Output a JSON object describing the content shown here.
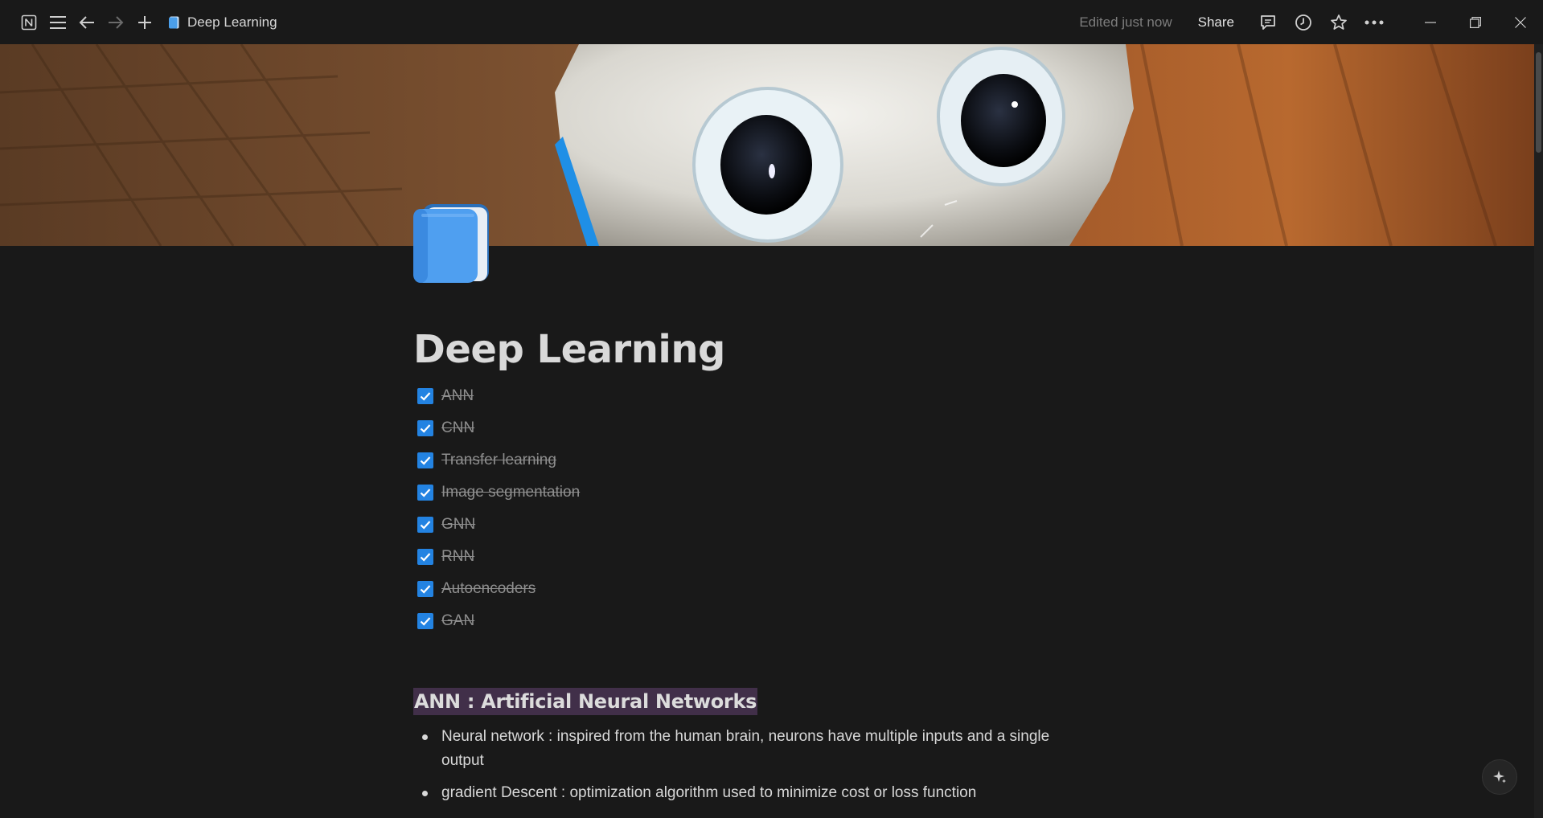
{
  "topbar": {
    "page_title": "Deep Learning",
    "edited": "Edited just now",
    "share": "Share"
  },
  "page": {
    "title": "Deep Learning",
    "icon": "blue-book-icon",
    "todos": [
      {
        "label": "ANN",
        "checked": true
      },
      {
        "label": "CNN",
        "checked": true
      },
      {
        "label": "Transfer learning",
        "checked": true
      },
      {
        "label": "Image segmentation",
        "checked": true
      },
      {
        "label": "GNN",
        "checked": true
      },
      {
        "label": "RNN",
        "checked": true
      },
      {
        "label": "Autoencoders",
        "checked": true
      },
      {
        "label": "GAN",
        "checked": true
      }
    ],
    "heading": "ANN : Artificial Neural Networks",
    "bullets": [
      "Neural network : inspired from the human brain, neurons have multiple inputs and a single output",
      "gradient Descent : optimization algorithm used to minimize cost or loss function"
    ]
  },
  "colors": {
    "background": "#191919",
    "accent": "#2383e2",
    "highlight": "#412f49"
  }
}
